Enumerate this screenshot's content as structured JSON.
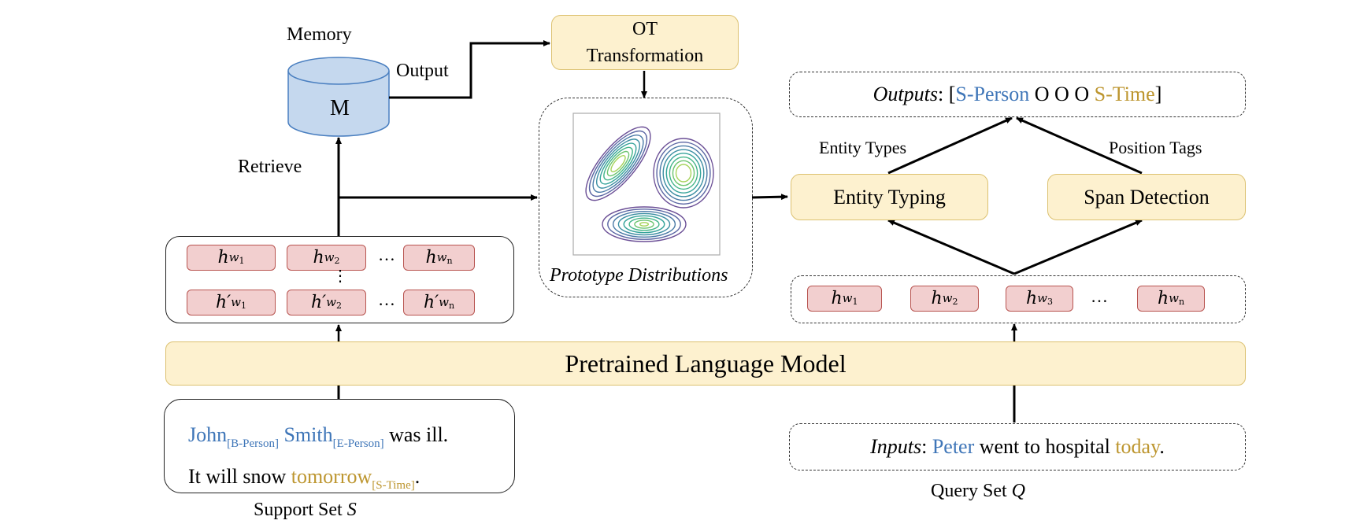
{
  "memory": {
    "title": "Memory",
    "symbol": "M",
    "output_label": "Output",
    "retrieve_label": "Retrieve"
  },
  "ot_transformation": {
    "line1": "OT",
    "line2": "Transformation"
  },
  "prototype_distributions": {
    "label": "Prototype Distributions"
  },
  "support_hidden_states": {
    "row1": [
      {
        "base": "h",
        "sub": "w",
        "index": "1"
      },
      {
        "base": "h",
        "sub": "w",
        "index": "2"
      },
      {
        "base": "h",
        "sub": "w",
        "index": "n"
      }
    ],
    "row2": [
      {
        "base": "h′",
        "sub": "w",
        "index": "1"
      },
      {
        "base": "h′",
        "sub": "w",
        "index": "2"
      },
      {
        "base": "h′",
        "sub": "w",
        "index": "n"
      }
    ],
    "ellipsis": "…",
    "vertical_ellipsis": "⋮"
  },
  "query_hidden_states": {
    "cells": [
      {
        "base": "h",
        "sub": "w",
        "index": "1"
      },
      {
        "base": "h",
        "sub": "w",
        "index": "2"
      },
      {
        "base": "h",
        "sub": "w",
        "index": "3"
      },
      {
        "base": "h",
        "sub": "w",
        "index": "n"
      }
    ],
    "ellipsis": "…"
  },
  "plm": {
    "label": "Pretrained Language Model"
  },
  "support_set": {
    "caption_prefix": "Support Set ",
    "caption_var": "S",
    "line1": [
      {
        "text": "John",
        "color": "blue"
      },
      {
        "text": "[B-Person]",
        "color": "blue",
        "sub": true
      },
      {
        "text": " Smith",
        "color": "blue"
      },
      {
        "text": "[E-Person]",
        "color": "blue",
        "sub": true
      },
      {
        "text": " was ill.",
        "color": "black"
      }
    ],
    "line2": [
      {
        "text": "It will snow ",
        "color": "black"
      },
      {
        "text": "tomorrow",
        "color": "gold"
      },
      {
        "text": "[S-Time]",
        "color": "gold",
        "sub": true
      },
      {
        "text": ".",
        "color": "black"
      }
    ]
  },
  "query_set": {
    "caption_prefix": "Query Set ",
    "caption_var": "Q",
    "inputs_label": "Inputs",
    "inputs_colon": ": ",
    "inputs": [
      {
        "text": "Peter",
        "color": "blue"
      },
      {
        "text": " went to hospital ",
        "color": "black"
      },
      {
        "text": "today",
        "color": "gold"
      },
      {
        "text": ".",
        "color": "black"
      }
    ]
  },
  "outputs": {
    "label": "Outputs",
    "colon": ": [",
    "tags": [
      {
        "text": "S-Person",
        "color": "blue"
      },
      {
        "text": " O O O ",
        "color": "black"
      },
      {
        "text": "S-Time",
        "color": "gold"
      }
    ],
    "close": "]"
  },
  "entity_typing": {
    "label": "Entity Typing",
    "edge_label": "Entity Types"
  },
  "span_detection": {
    "label": "Span Detection",
    "edge_label": "Position Tags"
  },
  "colors": {
    "blue": "#3f76b8",
    "gold": "#bd9630",
    "yellow_fill": "#fdf1cf",
    "yellow_border": "#dcc170",
    "cell_fill": "#f2cfcf",
    "cell_border": "#b85450",
    "cylinder_fill": "#c5d8ee",
    "cylinder_border": "#4a7fc0"
  }
}
